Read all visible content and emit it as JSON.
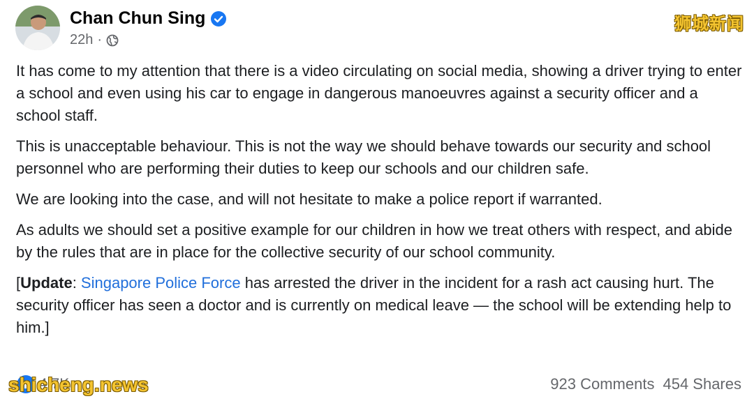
{
  "post": {
    "author": "Chan Chun Sing",
    "time": "22h",
    "separator": "·",
    "paragraphs": [
      "It has come to my attention that there is a video circulating on social media, showing a driver trying to enter a school and even using his car to engage in dangerous manoeuvres against a security officer and a school staff.",
      "This is unacceptable behaviour. This is not the way we should behave towards our security and school personnel who are performing their duties to keep our schools and our children safe.",
      "We are looking into the case, and will not hesitate to make a police report if warranted.",
      "As adults we should set a positive example for our children in how we treat others with respect, and abide by the rules that are in place for the collective security of our school community."
    ],
    "update": {
      "open_bracket": "[",
      "label": "Update",
      "colon": ": ",
      "link_text": "Singapore Police Force",
      "rest": " has arrested the driver in the incident for a rash act causing hurt. The security officer has seen a doctor and is currently on medical leave — the school will be extending help to him.]"
    }
  },
  "footer": {
    "reactions_count": "4.7K",
    "comments": "923 Comments",
    "shares": "454 Shares"
  },
  "watermarks": {
    "top_right": "狮城新闻",
    "bottom_left": "shicheng.news"
  },
  "colors": {
    "link": "#216fdb",
    "verified": "#1877f2",
    "watermark": "#f4c430"
  }
}
